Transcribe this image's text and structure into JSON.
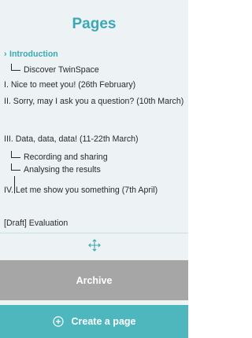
{
  "panel": {
    "title": "Pages",
    "pages": [
      {
        "label": "Introduction",
        "active": true
      },
      {
        "label": "Discover TwinSpace",
        "child": true
      },
      {
        "label": "I. Nice to meet you! (26th February)"
      },
      {
        "label": "II. Sorry, may I ask you a question? (10th March)"
      },
      {
        "label": "III. Data, data, data! (11-22th March)"
      },
      {
        "label": "Recording and sharing",
        "child": true
      },
      {
        "label": "Analysing the results",
        "child": true
      },
      {
        "label": "IV. Let me show you something (7th April)"
      },
      {
        "label": "[Draft] Evaluation"
      }
    ],
    "move_icon": "move-arrows-icon",
    "archive_label": "Archive",
    "create_label": "Create a page",
    "create_icon": "circle-plus-icon"
  },
  "colors": {
    "accent": "#3aa9b3",
    "panel_bg": "#edf2f4",
    "archive_bg": "#a6a6a6",
    "create_bg": "#4eb6bd",
    "text": "#2a2a2a"
  }
}
